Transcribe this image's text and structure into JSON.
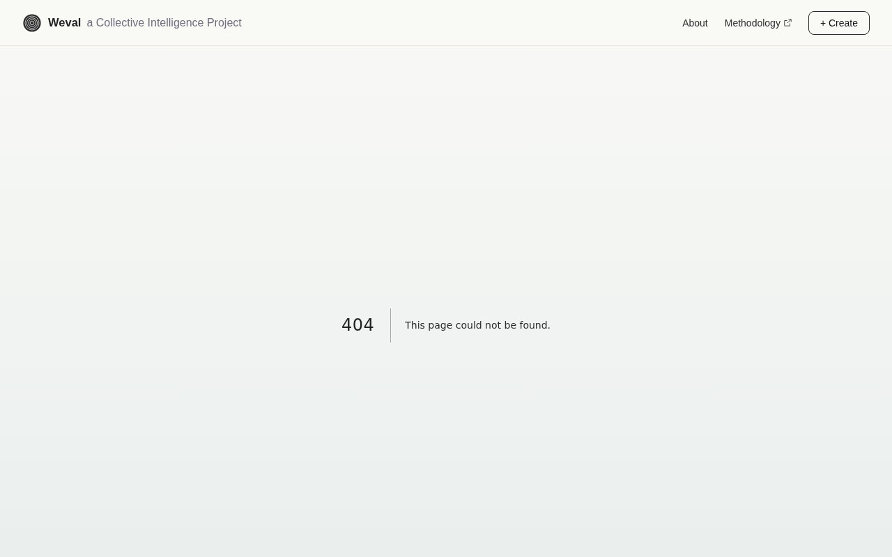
{
  "header": {
    "brand": "Weval",
    "tagline": "a Collective Intelligence Project",
    "nav": [
      {
        "label": "About",
        "external": false
      },
      {
        "label": "Methodology",
        "external": true
      }
    ],
    "create_button": "+ Create"
  },
  "error": {
    "code": "404",
    "message": "This page could not be found."
  }
}
